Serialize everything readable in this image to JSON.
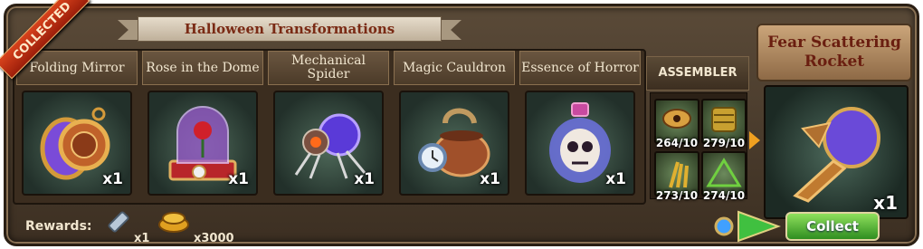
{
  "event_title": "Halloween Transformations",
  "status_ribbon": "COLLECTED",
  "slots": [
    {
      "name": "Folding Mirror",
      "qty": "x1",
      "icon": "mirror-icon"
    },
    {
      "name": "Rose in the Dome",
      "qty": "x1",
      "icon": "rose-dome-icon"
    },
    {
      "name": "Mechanical Spider",
      "qty": "x1",
      "icon": "spider-icon"
    },
    {
      "name": "Magic Cauldron",
      "qty": "x1",
      "icon": "cauldron-icon"
    },
    {
      "name": "Essence of Horror",
      "qty": "x1",
      "icon": "skull-bottle-icon"
    }
  ],
  "assembler": {
    "label": "ASSEMBLER",
    "items": [
      {
        "count": "264/10",
        "icon": "eye-amulet-icon"
      },
      {
        "count": "279/10",
        "icon": "scroll-icon"
      },
      {
        "count": "273/10",
        "icon": "wheat-icon"
      },
      {
        "count": "274/10",
        "icon": "pyramid-icon"
      }
    ]
  },
  "result": {
    "name": "Fear Scattering Rocket",
    "qty": "x1",
    "icon": "rocket-icon"
  },
  "rewards": {
    "label": "Rewards:",
    "items": [
      {
        "qty": "x1",
        "icon": "battery-icon"
      },
      {
        "qty": "x3000",
        "icon": "coins-icon"
      }
    ]
  },
  "collect_label": "Collect",
  "colors": {
    "accent_red": "#9c1e0a",
    "collect_green": "#2f8e20"
  }
}
